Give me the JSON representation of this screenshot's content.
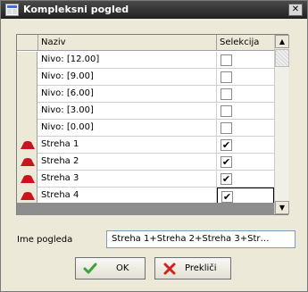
{
  "window": {
    "title": "Kompleksni pogled",
    "close_glyph": "✕"
  },
  "grid": {
    "columns": {
      "name": "Naziv",
      "selection": "Selekcija"
    },
    "rows": [
      {
        "name": "Nivo: [12.00]",
        "checked": false,
        "icon": null
      },
      {
        "name": "Nivo: [9.00]",
        "checked": false,
        "icon": null
      },
      {
        "name": "Nivo: [6.00]",
        "checked": false,
        "icon": null
      },
      {
        "name": "Nivo: [3.00]",
        "checked": false,
        "icon": null
      },
      {
        "name": "Nivo: [0.00]",
        "checked": false,
        "icon": null
      },
      {
        "name": "Streha 1",
        "checked": true,
        "icon": "roof-icon"
      },
      {
        "name": "Streha 2",
        "checked": true,
        "icon": "roof-icon"
      },
      {
        "name": "Streha 3",
        "checked": true,
        "icon": "roof-icon"
      },
      {
        "name": "Streha 4",
        "checked": true,
        "icon": "roof-icon"
      }
    ],
    "check_glyph": "✔"
  },
  "scrollbar": {
    "up_glyph": "▲",
    "down_glyph": "▼"
  },
  "view_name": {
    "label": "Ime pogleda",
    "value": "Streha 1+Streha 2+Streha 3+Str…"
  },
  "buttons": {
    "ok": "OK",
    "cancel": "Prekliči"
  },
  "colors": {
    "roof": "#c8141e",
    "check_green": "#3aa33a",
    "cancel_red": "#d42020"
  }
}
